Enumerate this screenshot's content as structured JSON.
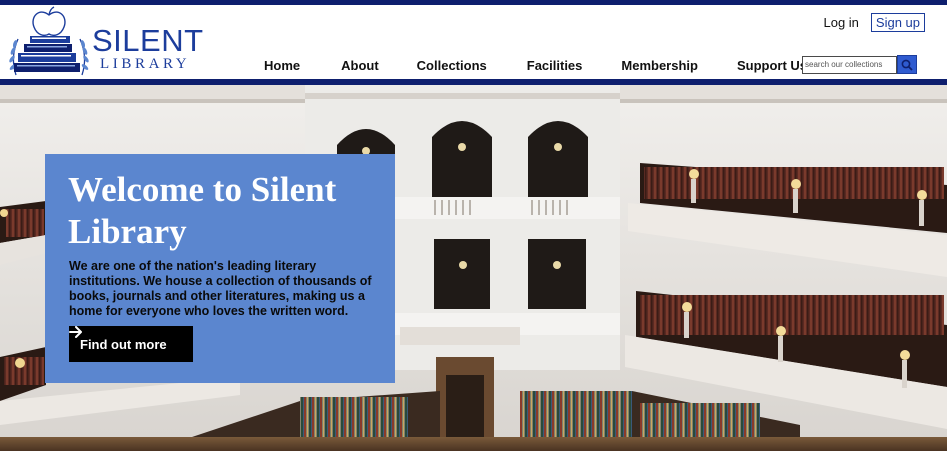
{
  "brand": {
    "name_line1": "SILENT",
    "name_line2": "LIBRARY"
  },
  "header": {
    "login_label": "Log in",
    "signup_label": "Sign up"
  },
  "nav": {
    "items": [
      {
        "label": "Home"
      },
      {
        "label": "About"
      },
      {
        "label": "Collections"
      },
      {
        "label": "Facilities"
      },
      {
        "label": "Membership"
      },
      {
        "label": "Support Us"
      }
    ]
  },
  "search": {
    "placeholder": "search our collections",
    "icon": "search-icon"
  },
  "hero": {
    "image": "library-reading-room-photo",
    "title": "Welcome to Silent Library",
    "description": "We are one of the nation's leading literary institutions. We house a collection of thousands of books, journals and other literatures, making us a home for everyone who loves the written word.",
    "cta_label": "Find out more",
    "cta_icon": "arrow-right-icon"
  },
  "colors": {
    "brand_navy": "#0e1f6e",
    "brand_blue": "#1c3d9c",
    "card_blue": "#5b86cf",
    "search_button": "#2f5bd0"
  }
}
